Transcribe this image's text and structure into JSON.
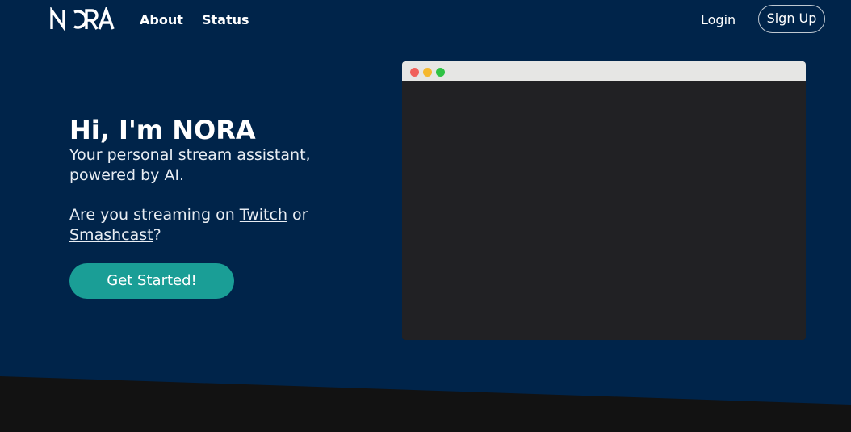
{
  "nav": {
    "logo_text": "NORA",
    "links": [
      {
        "label": "About"
      },
      {
        "label": "Status"
      }
    ],
    "login_label": "Login",
    "signup_label": "Sign Up"
  },
  "hero": {
    "title": "Hi, I'm NORA",
    "subtitle": "Your personal stream assistant, powered by AI.",
    "question_prefix": "Are you streaming on ",
    "question_link1": "Twitch",
    "question_mid": " or",
    "question_link2": "Smashcast",
    "question_suffix": "?",
    "cta_label": "Get Started!"
  },
  "colors": {
    "hero_bg": "#00244a",
    "footer_bg": "#121212",
    "accent": "#1a9e96",
    "browser_bar": "#e6e6e4",
    "browser_body": "#212124",
    "dot_red": "#f0605a",
    "dot_yellow": "#f5b82e",
    "dot_green": "#2fc244"
  }
}
